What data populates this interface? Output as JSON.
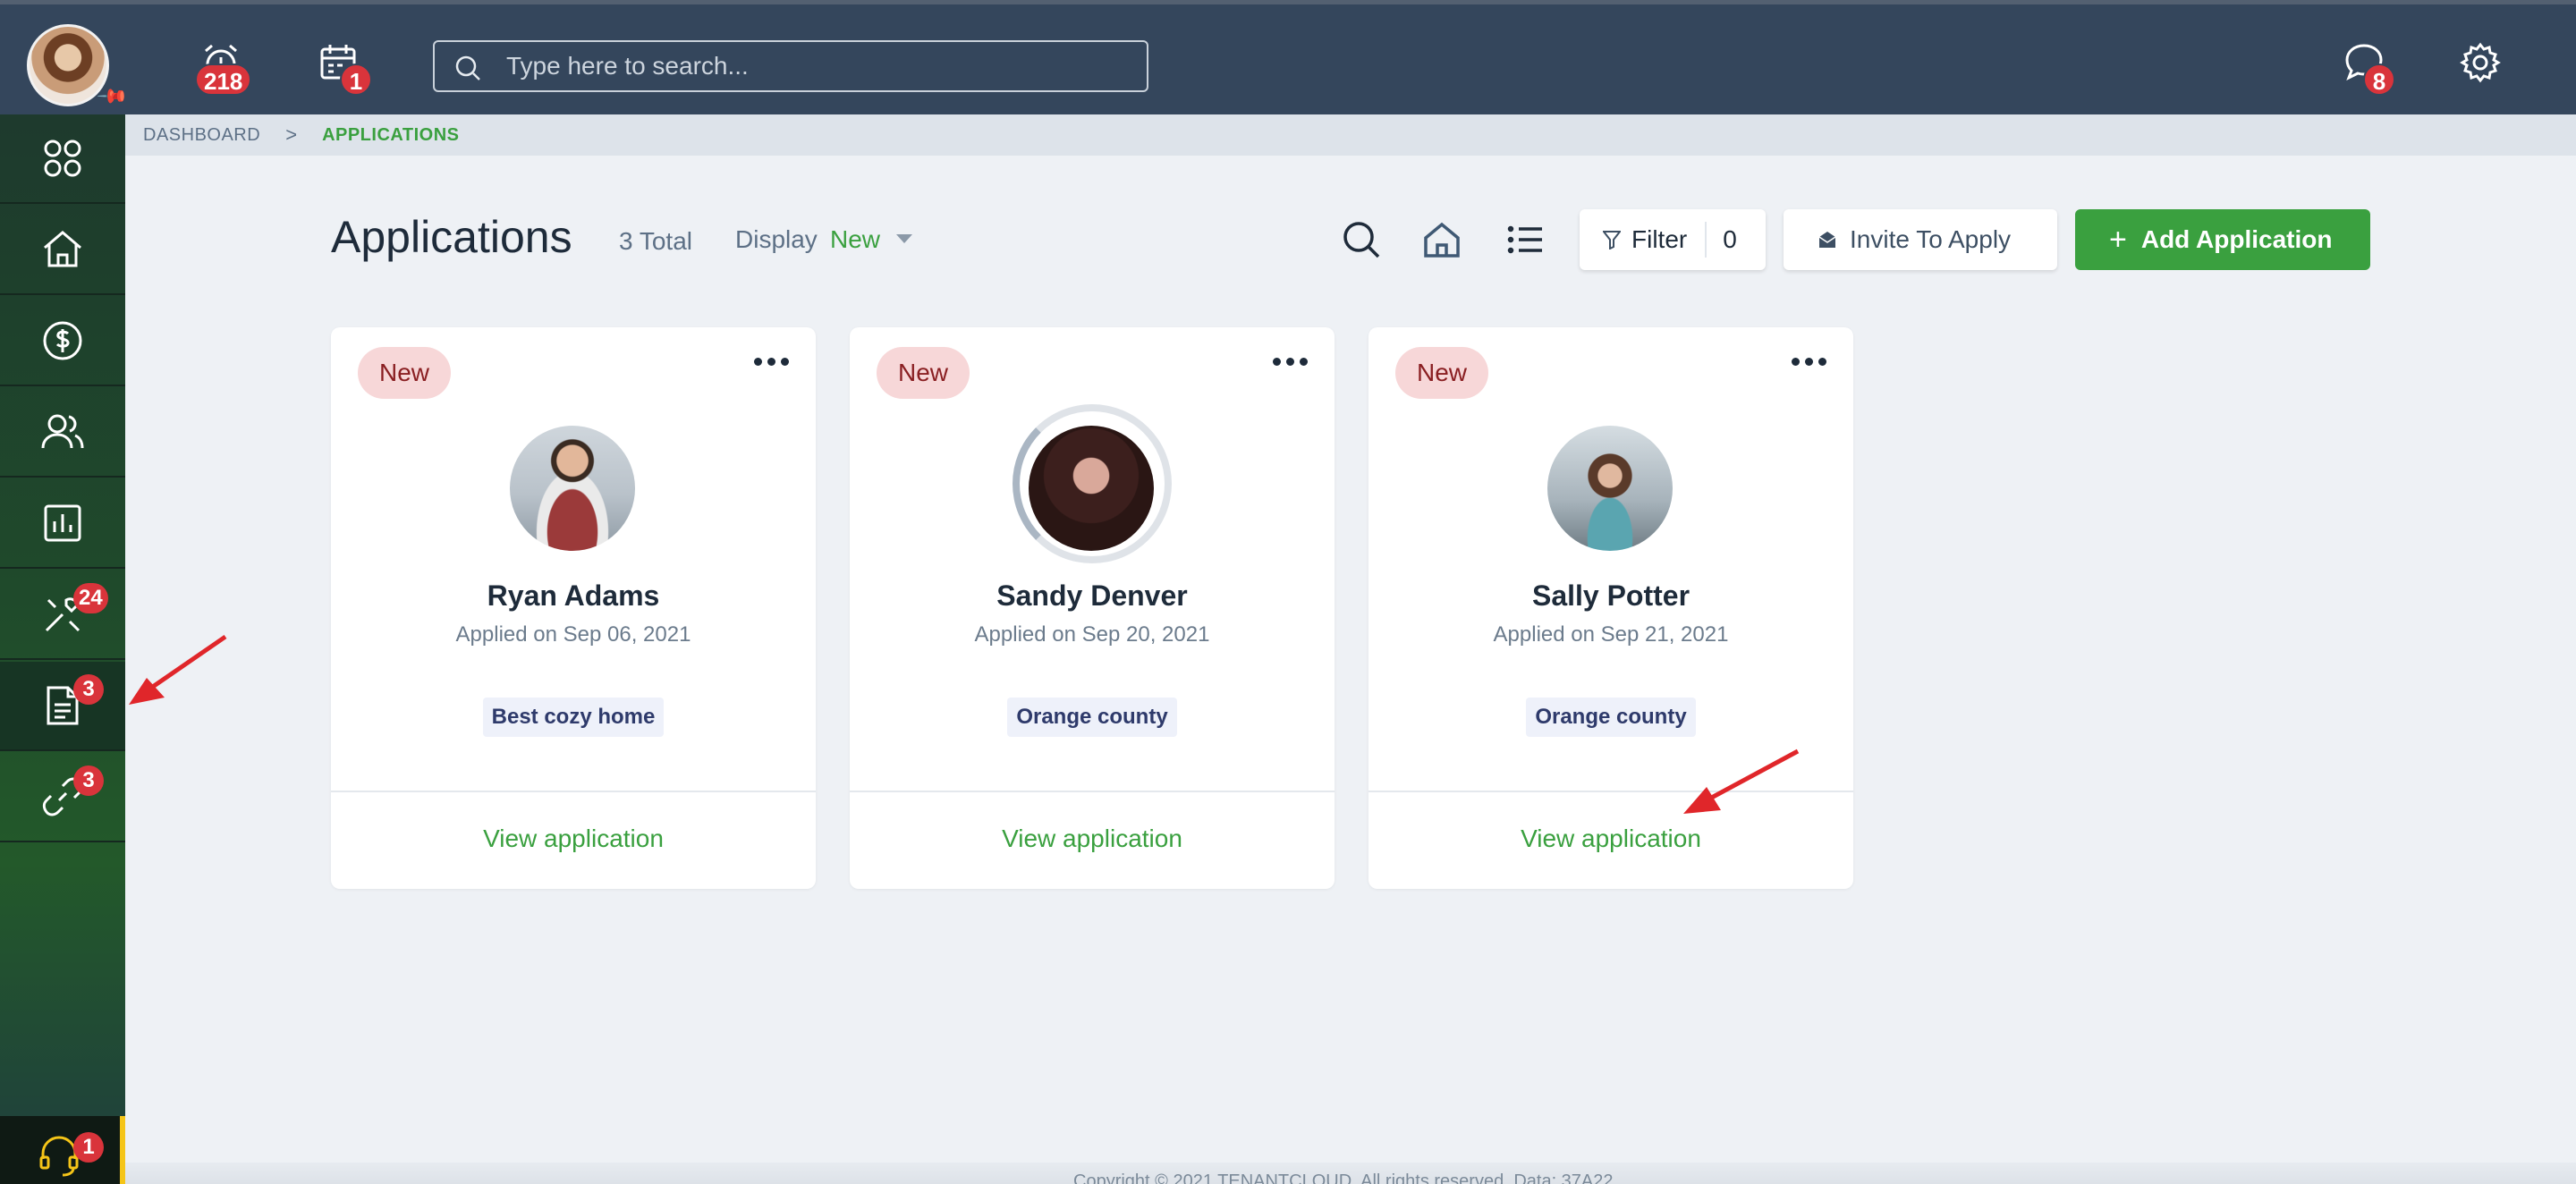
{
  "header": {
    "alarm_badge": "218",
    "calendar_badge": "1",
    "search_placeholder": "Type here to search...",
    "chat_badge": "8"
  },
  "sidebar": {
    "items": [
      {
        "name": "apps",
        "icon": "grid-icon",
        "badge": ""
      },
      {
        "name": "home",
        "icon": "home-icon",
        "badge": ""
      },
      {
        "name": "accounting",
        "icon": "dollar-icon",
        "badge": ""
      },
      {
        "name": "people",
        "icon": "people-icon",
        "badge": ""
      },
      {
        "name": "reports",
        "icon": "chart-icon",
        "badge": ""
      },
      {
        "name": "maintenance",
        "icon": "tools-icon",
        "badge": "24"
      },
      {
        "name": "applications",
        "icon": "document-icon",
        "badge": "3"
      },
      {
        "name": "links",
        "icon": "link-icon",
        "badge": "3"
      }
    ],
    "support_badge": "1"
  },
  "breadcrumb": {
    "root": "DASHBOARD",
    "separator": ">",
    "current": "APPLICATIONS"
  },
  "page": {
    "title": "Applications",
    "total": "3 Total",
    "display_label": "Display",
    "display_value": "New",
    "filter_label": "Filter",
    "filter_count": "0",
    "invite_label": "Invite To Apply",
    "add_label": "Add Application"
  },
  "cards": [
    {
      "tag": "New",
      "name": "Ryan Adams",
      "applied": "Applied on Sep 06, 2021",
      "property": "Best cozy home",
      "action": "View application"
    },
    {
      "tag": "New",
      "name": "Sandy Denver",
      "applied": "Applied on Sep 20, 2021",
      "property": "Orange county",
      "action": "View application"
    },
    {
      "tag": "New",
      "name": "Sally Potter",
      "applied": "Applied on Sep 21, 2021",
      "property": "Orange county",
      "action": "View application"
    }
  ],
  "footer": {
    "text": "Copyright © 2021 TENANTCLOUD. All rights reserved. Data: 37A22"
  },
  "colors": {
    "topbar": "#34465c",
    "accent_green": "#3aa03f",
    "badge_red": "#d9343b",
    "tag_bg": "#f7d7d8"
  }
}
